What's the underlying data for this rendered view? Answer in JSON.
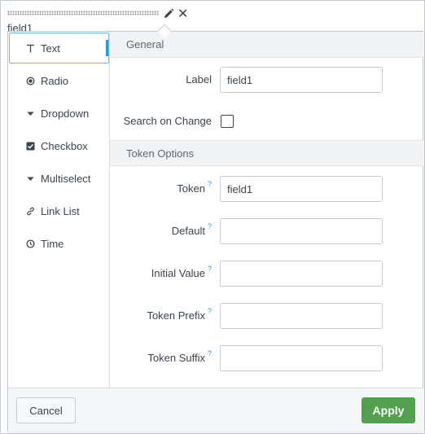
{
  "header": {
    "field_name": "field1",
    "edit_icon": "pencil-icon",
    "close_glyph": "✕"
  },
  "menu": {
    "items": [
      {
        "label": "Text",
        "icon": "text-icon",
        "active": true
      },
      {
        "label": "Radio",
        "icon": "radio-icon",
        "active": false
      },
      {
        "label": "Dropdown",
        "icon": "dropdown-caret-icon",
        "active": false
      },
      {
        "label": "Checkbox",
        "icon": "checkbox-icon",
        "active": false
      },
      {
        "label": "Multiselect",
        "icon": "multiselect-caret-icon",
        "active": false
      },
      {
        "label": "Link List",
        "icon": "link-icon",
        "active": false
      },
      {
        "label": "Time",
        "icon": "clock-icon",
        "active": false
      }
    ]
  },
  "general": {
    "title": "General",
    "label_label": "Label",
    "label_value": "field1",
    "search_on_change_label": "Search on Change",
    "search_on_change_checked": false
  },
  "token_options": {
    "title": "Token Options",
    "help_glyph": "?",
    "token_label": "Token",
    "token_value": "field1",
    "default_label": "Default",
    "default_value": "",
    "initial_value_label": "Initial Value",
    "initial_value_value": "",
    "token_prefix_label": "Token Prefix",
    "token_prefix_value": "",
    "token_suffix_label": "Token Suffix",
    "token_suffix_value": ""
  },
  "footer": {
    "cancel_label": "Cancel",
    "apply_label": "Apply"
  },
  "colors": {
    "accent": "#1a9ce0",
    "apply_green": "#53a051",
    "border": "#c3cbd4"
  }
}
